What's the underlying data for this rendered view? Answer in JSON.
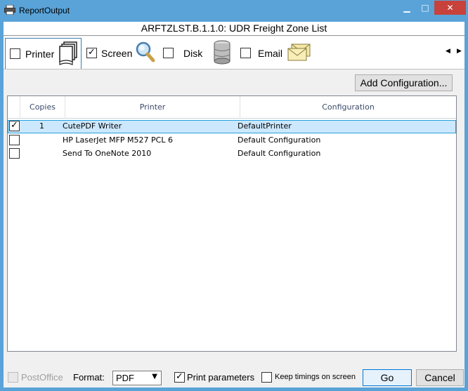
{
  "window": {
    "title": "ReportOutput",
    "min_glyph": "▁",
    "max_glyph": "□",
    "close_glyph": "✕"
  },
  "report": {
    "title": "ARFTZLST.B.1.1.0: UDR Freight Zone List"
  },
  "output_tabs": [
    {
      "label": "Printer",
      "checked": false,
      "icon": "printer-pages-icon",
      "selected": true
    },
    {
      "label": "Screen",
      "checked": true,
      "icon": "magnifier-icon",
      "selected": false
    },
    {
      "label": "Disk",
      "checked": false,
      "icon": "database-icon",
      "selected": false
    },
    {
      "label": "Email",
      "checked": false,
      "icon": "envelope-icon",
      "selected": false
    }
  ],
  "tab_scroll": {
    "left": "◀",
    "right": "▶"
  },
  "toolbar": {
    "add_configuration_label": "Add Configuration..."
  },
  "grid": {
    "columns": [
      "Copies",
      "Printer",
      "Configuration"
    ],
    "rows": [
      {
        "checked": true,
        "copies": "1",
        "printer": "CutePDF Writer",
        "configuration": "DefaultPrinter",
        "selected": true
      },
      {
        "checked": false,
        "copies": "",
        "printer": "HP LaserJet MFP M527 PCL 6",
        "configuration": "Default Configuration",
        "selected": false
      },
      {
        "checked": false,
        "copies": "",
        "printer": "Send To OneNote 2010",
        "configuration": "Default Configuration",
        "selected": false
      }
    ]
  },
  "footer": {
    "postoffice_label": "PostOffice",
    "format_label": "Format:",
    "format_value": "PDF",
    "print_parameters_label": "Print parameters",
    "print_parameters_checked": true,
    "keep_timings_label": "Keep timings on screen",
    "keep_timings_checked": false,
    "go_label": "Go",
    "cancel_label": "Cancel"
  },
  "colors": {
    "titlebar": "#5aa3d8",
    "close": "#c7423a",
    "selection": "#cce8ff",
    "selection_border": "#26a0da"
  }
}
